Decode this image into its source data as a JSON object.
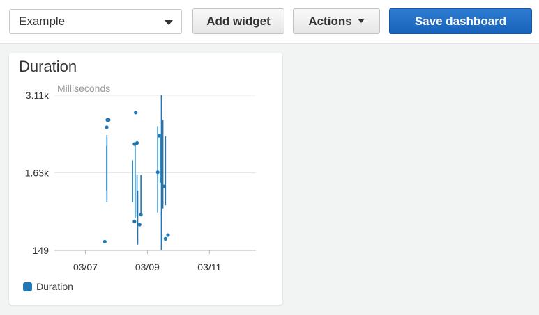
{
  "toolbar": {
    "dashboard_select": "Example",
    "add_widget_label": "Add widget",
    "actions_label": "Actions",
    "save_label": "Save dashboard"
  },
  "widget": {
    "title": "Duration",
    "legend_label": "Duration"
  },
  "colors": {
    "series": "#1f77b4",
    "save_button": "#1b6ec2",
    "grid": "#e8e8e8"
  },
  "chart_data": {
    "type": "line",
    "title": "Duration",
    "ylabel": "Milliseconds",
    "y_ticks": [
      "3.11k",
      "1.63k",
      "149"
    ],
    "y_tick_values": [
      3110,
      1630,
      149
    ],
    "ylim": [
      149,
      3110
    ],
    "x_ticks": [
      "03/07",
      "03/09",
      "03/11"
    ],
    "x_tick_values": [
      "2024-03-07",
      "2024-03-09",
      "2024-03-11"
    ],
    "xlim": [
      "2024-03-06T00:00",
      "2024-03-12T12:00"
    ],
    "legend": "bottom-left",
    "grid": true,
    "series": [
      {
        "name": "Duration",
        "segments": [
          [
            [
              "2024-03-07T16:30",
              1290
            ],
            [
              "2024-03-07T16:30",
              2140
            ]
          ],
          [
            [
              "2024-03-07T16:40",
              1070
            ],
            [
              "2024-03-07T16:40",
              2350
            ]
          ],
          [
            [
              "2024-03-08T12:30",
              1070
            ],
            [
              "2024-03-08T12:30",
              1870
            ]
          ],
          [
            [
              "2024-03-08T14:30",
              760
            ],
            [
              "2024-03-08T14:30",
              2200
            ]
          ],
          [
            [
              "2024-03-08T16:00",
              790
            ],
            [
              "2024-03-08T16:00",
              1600
            ]
          ],
          [
            [
              "2024-03-08T16:30",
              260
            ],
            [
              "2024-03-08T16:30",
              1290
            ]
          ],
          [
            [
              "2024-03-08T19:00",
              810
            ],
            [
              "2024-03-08T19:00",
              1590
            ]
          ],
          [
            [
              "2024-03-09T08:00",
              870
            ],
            [
              "2024-03-09T08:00",
              2520
            ]
          ],
          [
            [
              "2024-03-09T10:00",
              1440
            ],
            [
              "2024-03-09T10:00",
              2380
            ]
          ],
          [
            [
              "2024-03-09T10:50",
              149
            ],
            [
              "2024-03-09T10:50",
              3110
            ]
          ],
          [
            [
              "2024-03-09T12:00",
              950
            ],
            [
              "2024-03-09T12:00",
              2640
            ]
          ],
          [
            [
              "2024-03-09T14:00",
              1010
            ],
            [
              "2024-03-09T14:00",
              2330
            ]
          ]
        ],
        "points": [
          [
            "2024-03-07T15:00",
            315
          ],
          [
            "2024-03-07T16:30",
            2500
          ],
          [
            "2024-03-07T17:00",
            2640
          ],
          [
            "2024-03-07T18:00",
            2640
          ],
          [
            "2024-03-08T14:00",
            2180
          ],
          [
            "2024-03-08T15:00",
            2780
          ],
          [
            "2024-03-08T16:00",
            2200
          ],
          [
            "2024-03-08T14:00",
            700
          ],
          [
            "2024-03-08T18:00",
            640
          ],
          [
            "2024-03-08T19:00",
            830
          ],
          [
            "2024-03-09T08:00",
            1640
          ],
          [
            "2024-03-09T09:00",
            2340
          ],
          [
            "2024-03-09T13:00",
            1370
          ],
          [
            "2024-03-09T14:00",
            370
          ],
          [
            "2024-03-09T16:00",
            440
          ]
        ]
      }
    ]
  }
}
